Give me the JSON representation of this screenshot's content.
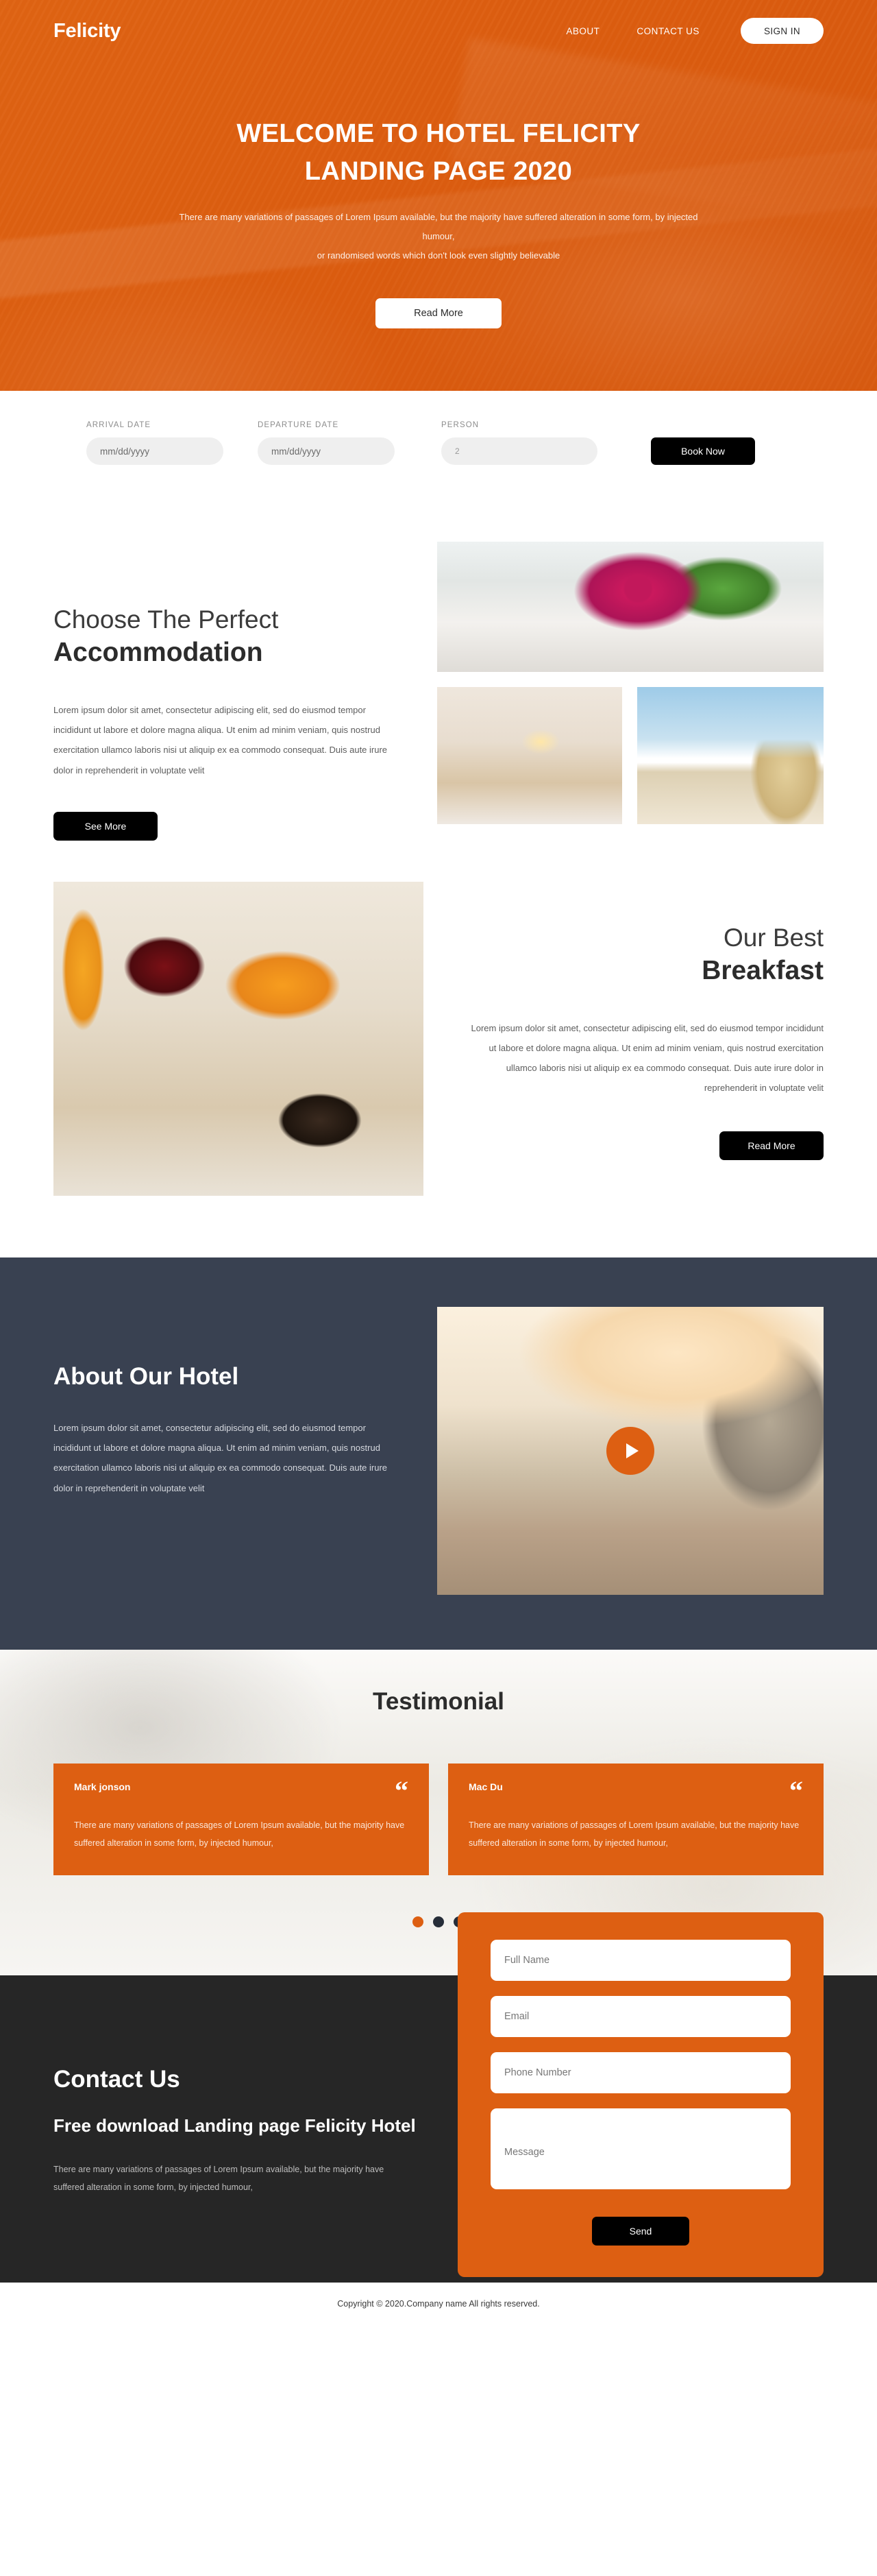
{
  "brand": {
    "name": "Felicity"
  },
  "nav": {
    "links": [
      {
        "label": "ABOUT"
      },
      {
        "label": "CONTACT US"
      }
    ],
    "signin_label": "SIGN IN"
  },
  "hero": {
    "title_line1": "WELCOME TO HOTEL FELICITY",
    "title_line2": "LANDING PAGE 2020",
    "subtitle_line1": "There are many variations of passages of Lorem Ipsum available, but the majority have suffered alteration in some form, by injected humour,",
    "subtitle_line2": "or randomised words which don't look even slightly believable",
    "cta_label": "Read More"
  },
  "booking": {
    "arrival_label": "ARRIVAL DATE",
    "arrival_placeholder": "mm/dd/yyyy",
    "departure_label": "DEPARTURE DATE",
    "departure_placeholder": "mm/dd/yyyy",
    "person_label": "PERSON",
    "person_placeholder": "2",
    "book_label": "Book Now"
  },
  "accommodation": {
    "title_light": "Choose The Perfect",
    "title_bold": "Accommodation",
    "body": "Lorem ipsum dolor sit amet, consectetur adipiscing elit, sed do eiusmod tempor incididunt ut labore et dolore magna aliqua. Ut enim ad minim veniam, quis nostrud exercitation ullamco laboris nisi ut aliquip ex ea commodo consequat. Duis aute irure dolor in reprehenderit in voluptate velit",
    "cta_label": "See More",
    "images": [
      {
        "alt": "white towels with red rose"
      },
      {
        "alt": "hotel room interior"
      },
      {
        "alt": "greek island white building"
      }
    ]
  },
  "breakfast": {
    "title_light": "Our Best",
    "title_bold": "Breakfast",
    "body": "Lorem ipsum dolor sit amet, consectetur adipiscing elit, sed do eiusmod tempor incididunt ut labore et dolore magna aliqua. Ut enim ad minim veniam, quis nostrud exercitation ullamco laboris nisi ut aliquip ex ea commodo consequat. Duis aute irure dolor in reprehenderit in voluptate velit",
    "cta_label": "Read More",
    "image_alt": "breakfast plate with orange juice, jam, oranges, pastry and coffee"
  },
  "about": {
    "title": "About Our Hotel",
    "body": "Lorem ipsum dolor sit amet, consectetur adipiscing elit, sed do eiusmod tempor incididunt ut labore et dolore magna aliqua. Ut enim ad minim veniam, quis nostrud exercitation ullamco laboris nisi ut aliquip ex ea commodo consequat. Duis aute irure dolor in reprehenderit in voluptate velit",
    "video_alt": "sunset terrace view over the sea",
    "play_icon": "play-icon"
  },
  "testimonial": {
    "title": "Testimonial",
    "quote_glyph": "“",
    "cards": [
      {
        "name": "Mark jonson",
        "text": "There are many variations of passages of Lorem Ipsum available, but the majority have suffered alteration in some form, by injected humour,"
      },
      {
        "name": "Mac Du",
        "text": "There are many variations of passages of Lorem Ipsum available, but the majority have suffered alteration in some form, by injected humour,"
      }
    ],
    "dots": [
      {
        "active": true
      },
      {
        "active": false
      },
      {
        "active": false
      }
    ]
  },
  "contact": {
    "title": "Contact Us",
    "subtitle": "Free download Landing page Felicity Hotel",
    "body": "There are many variations of passages of Lorem Ipsum available, but the majority have suffered alteration in some form, by injected humour,",
    "form": {
      "fullname_placeholder": "Full Name",
      "email_placeholder": "Email",
      "phone_placeholder": "Phone Number",
      "message_placeholder": "Message",
      "send_label": "Send"
    }
  },
  "footer": {
    "copyright": "Copyright © 2020.Company name All rights reserved."
  },
  "colors": {
    "accent": "#dd5f12",
    "dark_section": "#394151",
    "contact_bg": "#262626",
    "black": "#000000"
  }
}
